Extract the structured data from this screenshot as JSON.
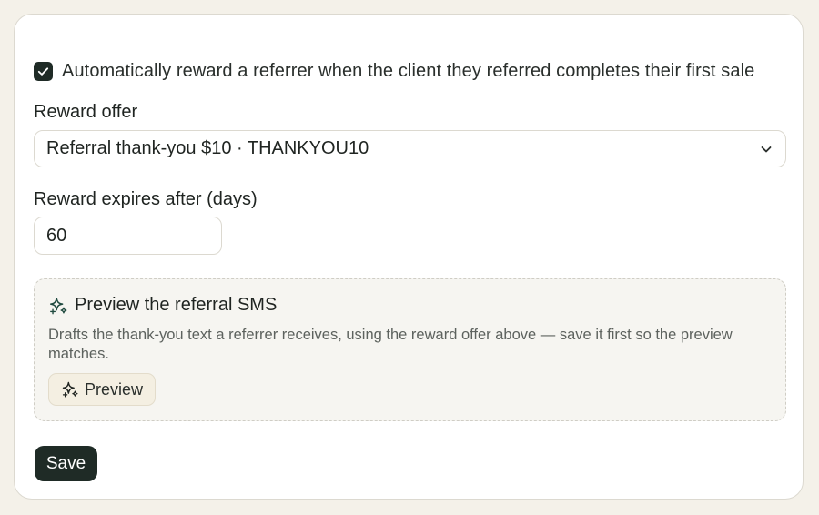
{
  "auto_reward": {
    "checked": true,
    "label": "Automatically reward a referrer when the client they referred completes their first sale"
  },
  "reward_offer": {
    "label": "Reward offer",
    "selected": "Referral thank-you $10 · THANKYOU10"
  },
  "reward_expiry": {
    "label": "Reward expires after (days)",
    "value": "60"
  },
  "sms_preview": {
    "title": "Preview the referral SMS",
    "description": "Drafts the thank-you text a referrer receives, using the reward offer above — save it first so the preview matches.",
    "button_label": "Preview"
  },
  "save_label": "Save",
  "colors": {
    "primary": "#1f2b26",
    "page_background": "#f4f1e9",
    "preview_background": "#f6f5f1",
    "preview_button_background": "#f4efe2"
  },
  "icons": {
    "checkbox": "check-icon",
    "select": "chevron-down-icon",
    "preview": "sparkle-icon"
  }
}
